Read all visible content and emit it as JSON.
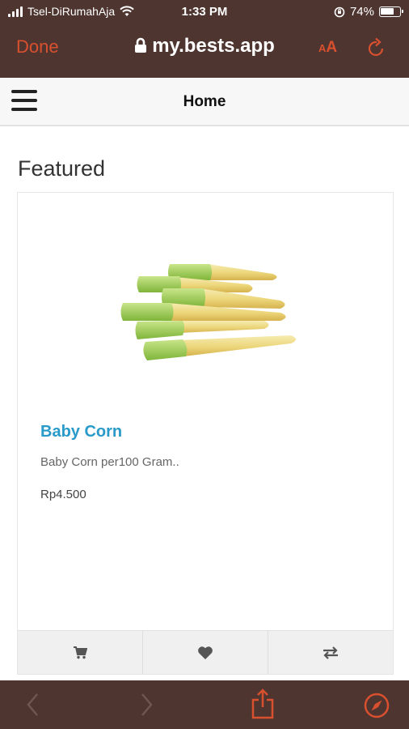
{
  "status_bar": {
    "carrier": "Tsel-DiRumahAja",
    "time": "1:33 PM",
    "battery_percent": "74%",
    "battery_level": 0.74
  },
  "browser": {
    "done_label": "Done",
    "url": "my.bests.app",
    "text_size_small": "A",
    "text_size_large": "A"
  },
  "app_header": {
    "title": "Home"
  },
  "section": {
    "title": "Featured"
  },
  "product": {
    "name": "Baby Corn",
    "description": "Baby Corn per100 Gram..",
    "price": "Rp4.500"
  },
  "product_actions": [
    {
      "icon": "cart-icon"
    },
    {
      "icon": "heart-icon"
    },
    {
      "icon": "compare-icon"
    }
  ],
  "toolbar_icons": [
    "back-icon",
    "forward-icon",
    "share-icon",
    "compass-icon"
  ],
  "colors": {
    "chrome_background": "#4e3530",
    "accent": "#d9502f",
    "product_link": "#2a9ac9"
  }
}
